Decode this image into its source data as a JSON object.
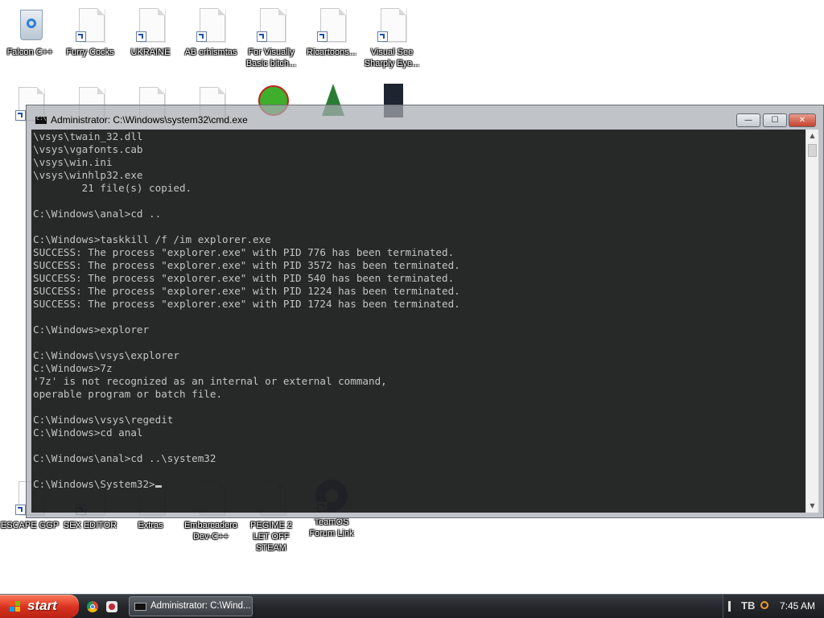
{
  "desktop": {
    "icons": [
      {
        "label": "Falcon C++",
        "type": "bin"
      },
      {
        "label": "Furry Cocks",
        "type": "doc"
      },
      {
        "label": "UKRAINE",
        "type": "doc"
      },
      {
        "label": "AB crhismtas",
        "type": "doc"
      },
      {
        "label": "For Visually Basic bitch...",
        "type": "doc"
      },
      {
        "label": "Ricartoons...",
        "type": "doc"
      },
      {
        "label": "Visual See Sharply Eye...",
        "type": "doc"
      },
      {
        "label": "ESCAPE GGP",
        "type": "doc"
      },
      {
        "label": "SEX EDITOR",
        "type": "doc"
      },
      {
        "label": "Extras",
        "type": "doc"
      },
      {
        "label": "Embarcadero Dev-C++",
        "type": "doc"
      },
      {
        "label": "PEGIME 2 LET OFF STEAM",
        "type": "doc"
      },
      {
        "label": "TeamOS Forum Link",
        "type": "gear"
      }
    ]
  },
  "window": {
    "title": "Administrator: C:\\Windows\\system32\\cmd.exe",
    "minimize_symbol": "—",
    "maximize_symbol": "☐",
    "close_symbol": "✕",
    "console_lines": [
      "\\vsys\\twain_32.dll",
      "\\vsys\\vgafonts.cab",
      "\\vsys\\win.ini",
      "\\vsys\\winhlp32.exe",
      "        21 file(s) copied.",
      "",
      "C:\\Windows\\anal>cd ..",
      "",
      "C:\\Windows>taskkill /f /im explorer.exe",
      "SUCCESS: The process \"explorer.exe\" with PID 776 has been terminated.",
      "SUCCESS: The process \"explorer.exe\" with PID 3572 has been terminated.",
      "SUCCESS: The process \"explorer.exe\" with PID 540 has been terminated.",
      "SUCCESS: The process \"explorer.exe\" with PID 1224 has been terminated.",
      "SUCCESS: The process \"explorer.exe\" with PID 1724 has been terminated.",
      "",
      "C:\\Windows>explorer",
      "",
      "C:\\Windows\\vsys\\explorer",
      "C:\\Windows>7z",
      "'7z' is not recognized as an internal or external command,",
      "operable program or batch file.",
      "",
      "C:\\Windows\\vsys\\regedit",
      "C:\\Windows>cd anal",
      "",
      "C:\\Windows\\anal>cd ..\\system32",
      ""
    ],
    "prompt": "C:\\Windows\\System32>"
  },
  "taskbar": {
    "start_label": "start",
    "task_label": "Administrator: C:\\Wind...",
    "clock": "7:45 AM",
    "tray_text": "TB"
  }
}
